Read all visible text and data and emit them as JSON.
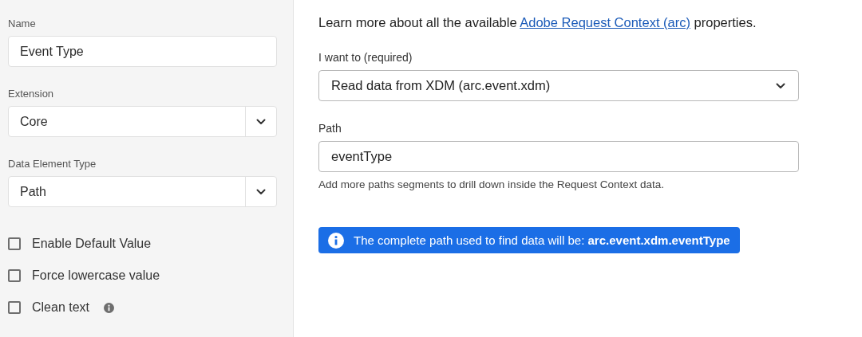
{
  "sidebar": {
    "fields": [
      {
        "kind": "text",
        "label": "Name",
        "value": "Event Type"
      },
      {
        "kind": "select",
        "label": "Extension",
        "value": "Core"
      },
      {
        "kind": "select",
        "label": "Data Element Type",
        "value": "Path"
      }
    ],
    "options": [
      {
        "label": "Enable Default Value",
        "checked": false,
        "info": false
      },
      {
        "label": "Force lowercase value",
        "checked": false,
        "info": false
      },
      {
        "label": "Clean text",
        "checked": false,
        "info": true
      }
    ]
  },
  "main": {
    "intro": {
      "before": "Learn more about all the available",
      "link": "Adobe Request Context (arc)",
      "after": "properties."
    },
    "fields": [
      {
        "kind": "select",
        "label": "I want to (required)",
        "value": "Read data from XDM (arc.event.xdm)"
      },
      {
        "kind": "text",
        "label": "Path",
        "value": "eventType",
        "help": "Add more paths segments to drill down inside the Request Context data."
      }
    ],
    "banner": "The complete path used to find data will be: **arc.event.xdm.eventType**"
  }
}
